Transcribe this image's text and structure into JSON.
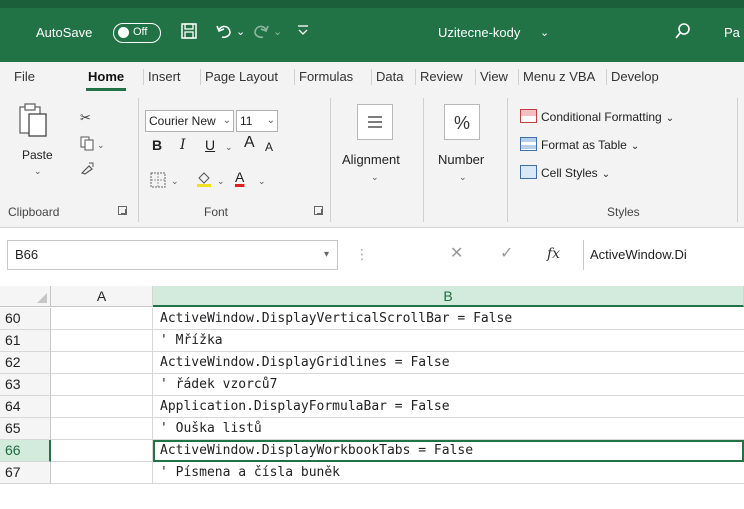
{
  "titlebar": {
    "autosave_label": "AutoSave",
    "autosave_state": "Off",
    "filename": "Uzitecne-kody",
    "filename_chevron": "⌄",
    "user_initials": "Pa",
    "icons": [
      "save-icon",
      "undo-icon",
      "redo-icon",
      "customize-qat-icon",
      "search-icon"
    ]
  },
  "tabs": [
    {
      "label": "File"
    },
    {
      "label": "Home",
      "active": true
    },
    {
      "label": "Insert"
    },
    {
      "label": "Page Layout"
    },
    {
      "label": "Formulas"
    },
    {
      "label": "Data"
    },
    {
      "label": "Review"
    },
    {
      "label": "View"
    },
    {
      "label": "Menu z VBA"
    },
    {
      "label": "Develop"
    }
  ],
  "ribbon": {
    "clipboard": {
      "group_label": "Clipboard",
      "paste_label": "Paste"
    },
    "font": {
      "group_label": "Font",
      "font_name": "Courier New",
      "font_size": "11",
      "bold": "B",
      "italic": "I",
      "underline": "U",
      "grow": "A",
      "shrink": "A",
      "font_color_glyph": "A",
      "font_color": "#e02020"
    },
    "alignment": {
      "label": "Alignment"
    },
    "number": {
      "label": "Number",
      "icon_glyph": "%"
    },
    "styles": {
      "group_label": "Styles",
      "conditional_formatting": "Conditional Formatting",
      "format_as_table": "Format as Table",
      "cell_styles": "Cell Styles"
    }
  },
  "formula_bar": {
    "name_box": "B66",
    "fx_label": "fx",
    "content": "ActiveWindow.Di"
  },
  "grid": {
    "columns": [
      "A",
      "B"
    ],
    "selected_column": "B",
    "selected_row": "66",
    "rows": [
      {
        "row": "60",
        "b": "ActiveWindow.DisplayVerticalScrollBar = False"
      },
      {
        "row": "61",
        "b": "' Mřížka"
      },
      {
        "row": "62",
        "b": "ActiveWindow.DisplayGridlines = False"
      },
      {
        "row": "63",
        "b": "' řádek vzorců7"
      },
      {
        "row": "64",
        "b": "Application.DisplayFormulaBar = False"
      },
      {
        "row": "65",
        "b": "' Ouška listů"
      },
      {
        "row": "66",
        "b": "ActiveWindow.DisplayWorkbookTabs = False",
        "active": true
      },
      {
        "row": "67",
        "b": "' Písmena a čísla buněk"
      }
    ]
  },
  "colors": {
    "accent": "#217346",
    "selected_header_bg": "#d2ebdd"
  }
}
